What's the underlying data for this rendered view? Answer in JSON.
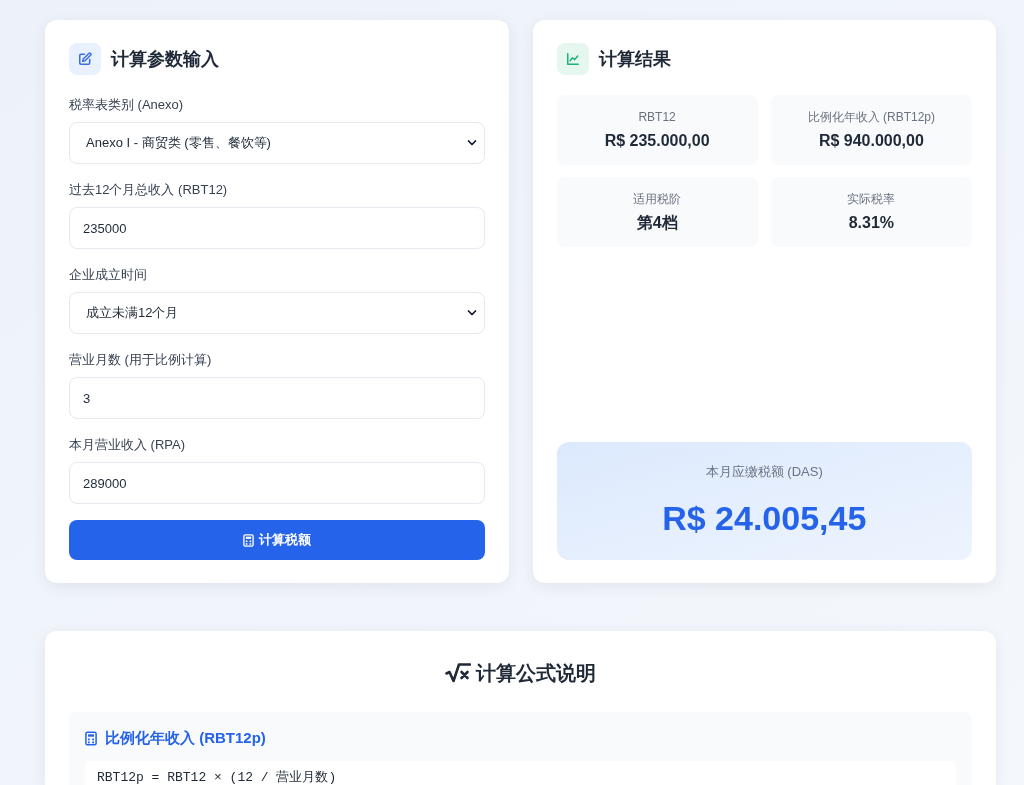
{
  "input_panel": {
    "title": "计算参数输入",
    "fields": [
      {
        "kind": "select",
        "label": "税率表类别 (Anexo)",
        "value": "Anexo I - 商贸类 (零售、餐饮等)"
      },
      {
        "kind": "text",
        "label": "过去12个月总收入 (RBT12)",
        "value": "235000"
      },
      {
        "kind": "select",
        "label": "企业成立时间",
        "value": "成立未满12个月"
      },
      {
        "kind": "text",
        "label": "营业月数 (用于比例计算)",
        "value": "3"
      },
      {
        "kind": "text",
        "label": "本月营业收入 (RPA)",
        "value": "289000"
      }
    ],
    "button": "计算税额"
  },
  "results_panel": {
    "title": "计算结果",
    "stats": [
      {
        "label": "RBT12",
        "value": "R$ 235.000,00"
      },
      {
        "label": "比例化年收入 (RBT12p)",
        "value": "R$ 940.000,00"
      },
      {
        "label": "适用税阶",
        "value": "第4档"
      },
      {
        "label": "实际税率",
        "value": "8.31%"
      }
    ],
    "total": {
      "label": "本月应缴税额 (DAS)",
      "value": "R$ 24.005,45"
    }
  },
  "formula_section": {
    "title": "计算公式说明",
    "blocks": [
      {
        "title": "比例化年收入 (RBT12p)",
        "formula": "RBT12p = RBT12 × (12 / 营业月数)"
      }
    ]
  }
}
